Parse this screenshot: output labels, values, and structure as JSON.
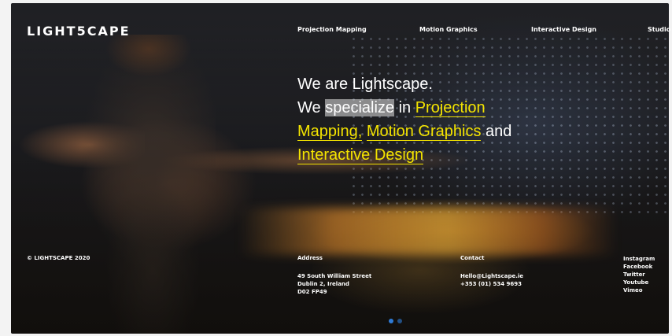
{
  "brand": {
    "logo": "LIGHT5CAPE"
  },
  "nav": {
    "items": [
      {
        "label": "Projection Mapping"
      },
      {
        "label": "Motion Graphics"
      },
      {
        "label": "Interactive Design"
      },
      {
        "label": "Studio"
      }
    ]
  },
  "hero": {
    "line1": "We are Lightscape.",
    "line2_prefix": "We ",
    "line2_selected": "specialize",
    "line2_mid": " in ",
    "line2_link": "Projection",
    "line3_link1": "Mapping,",
    "line3_link2": "Motion Graphics",
    "line3_suffix": " and",
    "line4_link": "Interactive Design"
  },
  "footer": {
    "copyright": "© LIGHTSCAPE 2020",
    "address_heading": "Address",
    "address_lines": [
      "49 South William Street",
      "Dublin 2, Ireland",
      "D02 FP49"
    ],
    "contact_heading": "Contact",
    "contact_lines": [
      "Hello@Lightscape.ie",
      "+353 (01) 534 9693"
    ],
    "social": [
      "Instagram",
      "Facebook",
      "Twitter",
      "Youtube",
      "Vimeo"
    ]
  },
  "colors": {
    "accent": "#f4e400",
    "text": "#ffffff",
    "pager_active": "#2f7bd6"
  },
  "pager": {
    "count": 2,
    "active_index": 0
  }
}
